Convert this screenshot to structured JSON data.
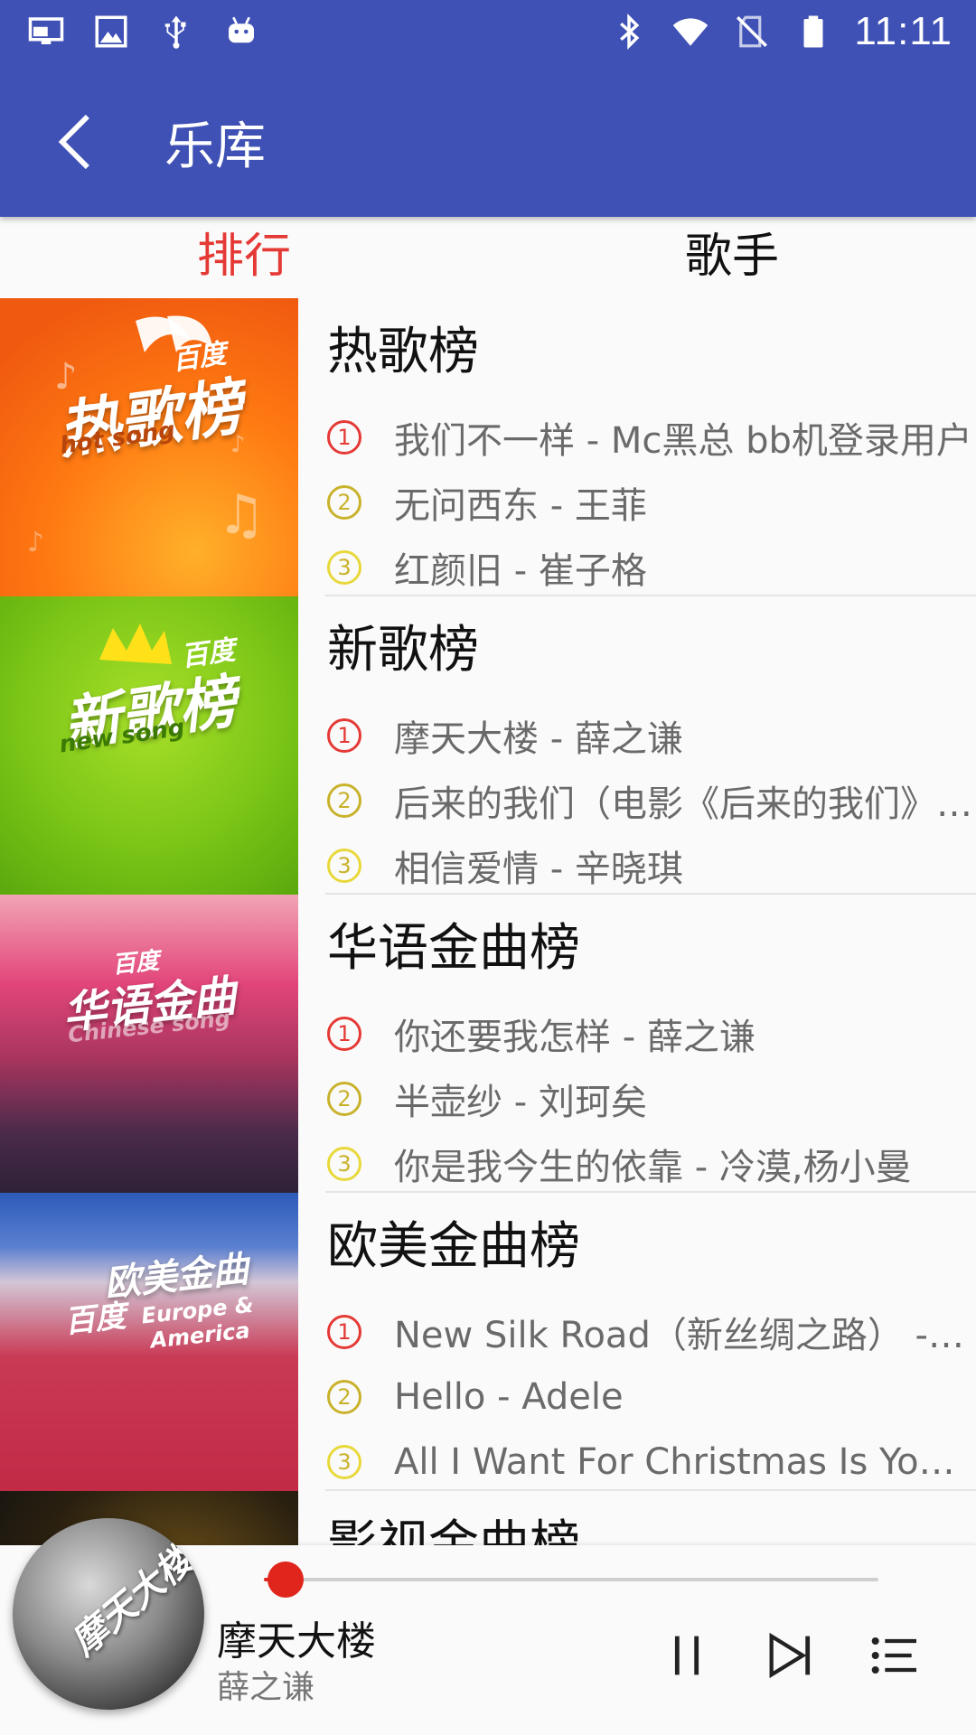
{
  "status_bar": {
    "time": "11:11",
    "left_icons": [
      "screen-mirror-icon",
      "image-icon",
      "usb-icon",
      "android-icon"
    ],
    "right_icons": [
      "bluetooth-icon",
      "wifi-icon",
      "no-sim-icon",
      "battery-icon"
    ]
  },
  "toolbar": {
    "title": "乐库",
    "back_icon": "back-arrow-icon",
    "color": "#3f51b5"
  },
  "tabs": [
    {
      "label": "排行",
      "active": true
    },
    {
      "label": "歌手",
      "active": false
    }
  ],
  "accent_color": "#e53935",
  "charts": [
    {
      "name": "热歌榜",
      "cover_title": "热歌榜",
      "cover_brand": "百度",
      "cover_sub": "hot song",
      "songs": [
        {
          "rank": "1",
          "text": "我们不一样 - Mc黑总 bb机登录用户"
        },
        {
          "rank": "2",
          "text": "无问西东 - 王菲"
        },
        {
          "rank": "3",
          "text": "红颜旧 - 崔子格"
        }
      ]
    },
    {
      "name": "新歌榜",
      "cover_title": "新歌榜",
      "cover_brand": "百度",
      "cover_sub": "new song",
      "songs": [
        {
          "rank": "1",
          "text": "摩天大楼 - 薛之谦"
        },
        {
          "rank": "2",
          "text": "后来的我们（电影《后来的我们》主题曲）"
        },
        {
          "rank": "3",
          "text": "相信爱情 - 辛晓琪"
        }
      ]
    },
    {
      "name": "华语金曲榜",
      "cover_title": "华语金曲",
      "cover_brand": "百度",
      "cover_sub": "Chinese song",
      "songs": [
        {
          "rank": "1",
          "text": "你还要我怎样 - 薛之谦"
        },
        {
          "rank": "2",
          "text": "半壶纱 - 刘珂矣"
        },
        {
          "rank": "3",
          "text": "你是我今生的依靠 - 冷漠,杨小曼"
        }
      ]
    },
    {
      "name": "欧美金曲榜",
      "cover_title": "欧美金曲",
      "cover_brand": "百度",
      "cover_sub": "Europe & America",
      "songs": [
        {
          "rank": "1",
          "text": "New Silk Road（新丝绸之路） - Maksim"
        },
        {
          "rank": "2",
          "text": "Hello - Adele"
        },
        {
          "rank": "3",
          "text": "All I Want For Christmas Is You - Mariah Carey"
        }
      ]
    },
    {
      "name": "影视金曲榜",
      "cover_title": "",
      "cover_brand": "",
      "cover_sub": "",
      "songs": []
    }
  ],
  "player": {
    "title": "摩天大楼",
    "artist": "薛之谦",
    "cover_text": "摩天大楼",
    "progress": 0.03,
    "controls": [
      "pause-icon",
      "next-icon",
      "playlist-icon"
    ]
  }
}
